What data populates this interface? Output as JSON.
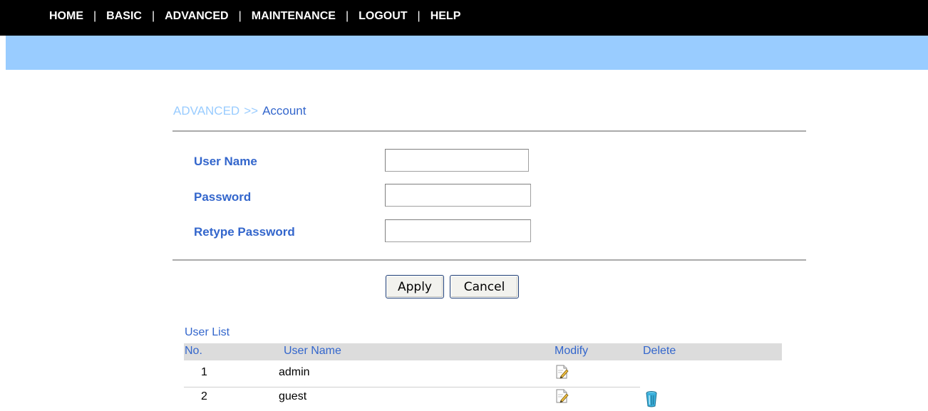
{
  "nav": {
    "items": [
      "HOME",
      "BASIC",
      "ADVANCED",
      "MAINTENANCE",
      "LOGOUT",
      "HELP"
    ],
    "separator": "|"
  },
  "breadcrumb": {
    "parent": "ADVANCED",
    "separator": ">>",
    "current": "Account"
  },
  "form": {
    "user_name_label": "User Name",
    "password_label": "Password",
    "retype_password_label": "Retype Password",
    "user_name_value": "",
    "password_value": "",
    "retype_password_value": ""
  },
  "buttons": {
    "apply": "Apply",
    "cancel": "Cancel"
  },
  "user_list": {
    "title": "User List",
    "columns": [
      "No.",
      "User Name",
      "Modify",
      "Delete"
    ],
    "rows": [
      {
        "no": "1",
        "user_name": "admin",
        "modify_icon": "edit-icon",
        "delete_icon": null
      },
      {
        "no": "2",
        "user_name": "guest",
        "modify_icon": "edit-icon",
        "delete_icon": "trash-icon"
      }
    ]
  },
  "colors": {
    "nav_background": "#000000",
    "band": "#99ccff",
    "label_blue": "#3366cc",
    "breadcrumb_parent": "#99ccff",
    "table_header": "#dcdcdc"
  }
}
